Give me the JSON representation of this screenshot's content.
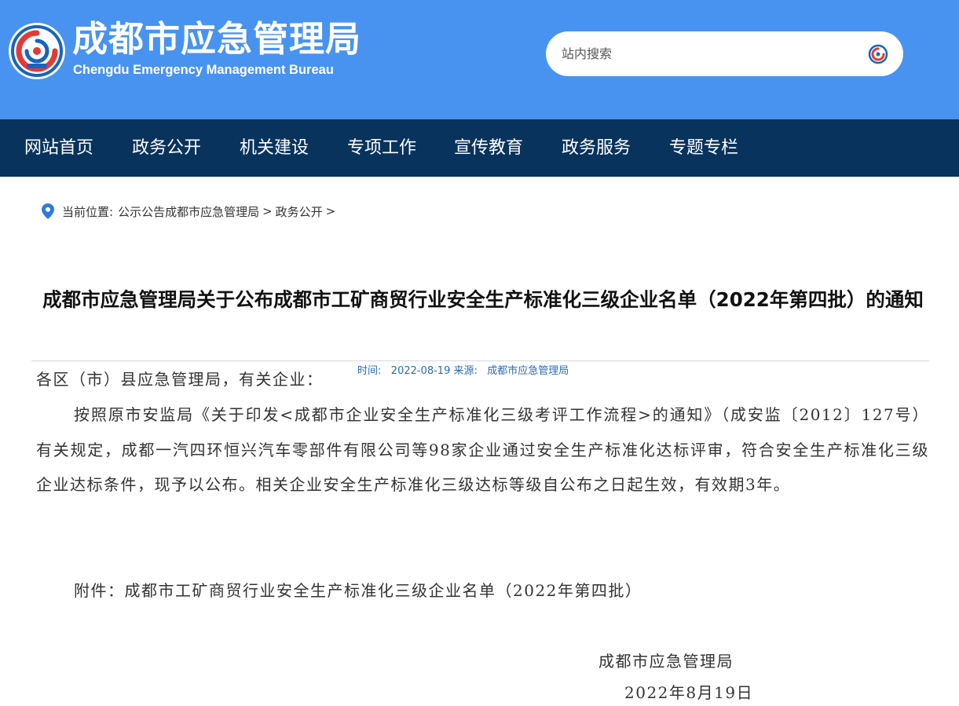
{
  "header": {
    "title_cn": "成都市应急管理局",
    "title_en": "Chengdu Emergency Management Bureau",
    "logo_icon": "bureau-emblem-icon",
    "colors": {
      "header_bg": "#4893f0",
      "nav_bg": "#08335d",
      "emblem_red": "#e53935",
      "emblem_blue": "#1565c0"
    }
  },
  "search": {
    "placeholder": "站内搜索",
    "button_icon": "search-emblem-icon"
  },
  "nav": {
    "items": [
      {
        "label": "网站首页"
      },
      {
        "label": "政务公开"
      },
      {
        "label": "机关建设"
      },
      {
        "label": "专项工作"
      },
      {
        "label": "宣传教育"
      },
      {
        "label": "政务服务"
      },
      {
        "label": "专题专栏"
      }
    ]
  },
  "breadcrumb": {
    "icon": "location-pin-icon",
    "prefix": "当前位置:",
    "items": [
      {
        "label": "公示公告成都市应急管理局"
      },
      {
        "label": "政务公开"
      }
    ],
    "separator": ">"
  },
  "article": {
    "title": "成都市应急管理局关于公布成都市工矿商贸行业安全生产标准化三级企业名单（2022年第四批）的通知",
    "meta": {
      "time_label": "时间:",
      "time_value": "2022-08-19",
      "source_label": "来源:",
      "source_value": "成都市应急管理局"
    },
    "greeting": "各区（市）县应急管理局，有关企业：",
    "paragraph": "按照原市安监局《关于印发<成都市企业安全生产标准化三级考评工作流程>的通知》（成安监〔2012〕127号）有关规定，成都一汽四环恒兴汽车零部件有限公司等98家企业通过安全生产标准化达标评审，符合安全生产标准化三级企业达标条件，现予以公布。相关企业安全生产标准化三级达标等级自公布之日起生效，有效期3年。",
    "attachment": "附件：成都市工矿商贸行业安全生产标准化三级企业名单（2022年第四批）",
    "signature_org": "成都市应急管理局",
    "signature_date": "2022年8月19日"
  }
}
